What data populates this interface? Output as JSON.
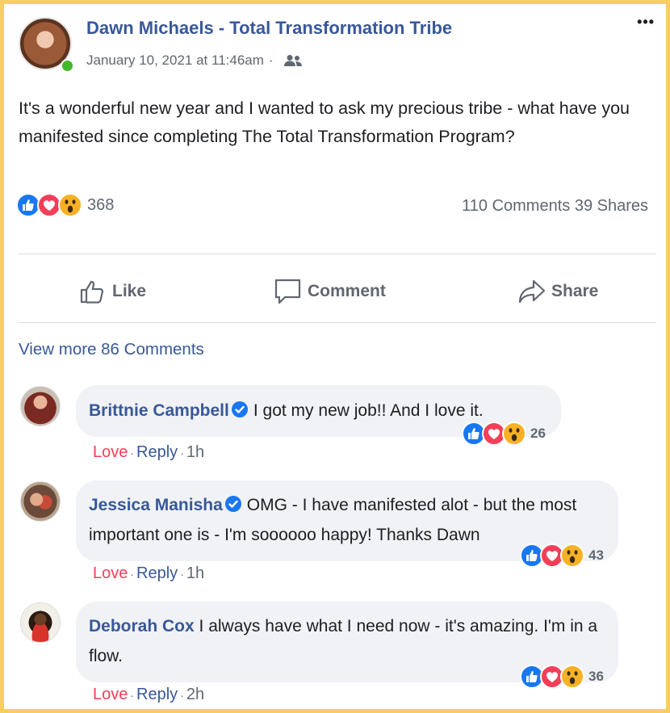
{
  "post": {
    "author": "Dawn Michaels - Total Transformation Tribe",
    "timestamp": "January 10, 2021 at 11:46am",
    "separator": "·",
    "more_icon": "•••",
    "text": "It's a wonderful new year and I wanted to ask my precious tribe - what have you manifested since completing The Total Transformation Program?",
    "reaction_count": "368",
    "stats": "110 Comments 39 Shares"
  },
  "actions": {
    "like": "Like",
    "comment": "Comment",
    "share": "Share"
  },
  "view_more": "View more 86 Comments",
  "comments": [
    {
      "name": "Brittnie Campbell",
      "text": "I got my new job!! And I love it.",
      "reactions": "26",
      "love": "Love",
      "reply": "Reply",
      "sep": "·",
      "time": "1h"
    },
    {
      "name": "Jessica Manisha",
      "text": "OMG - I have manifested alot - but the most important one is - I'm soooooo happy! Thanks Dawn",
      "reactions": "43",
      "love": "Love",
      "reply": "Reply",
      "sep": "·",
      "time": "1h"
    },
    {
      "name": "Deborah Cox",
      "text": "I always have what I need now - it's amazing. I'm in a flow.",
      "reactions": "36",
      "love": "Love",
      "reply": "Reply",
      "sep": "·",
      "time": "2h"
    }
  ],
  "colors": {
    "frame": "#f7ce63",
    "link": "#385898",
    "love": "#f33e58",
    "muted": "#606770"
  }
}
